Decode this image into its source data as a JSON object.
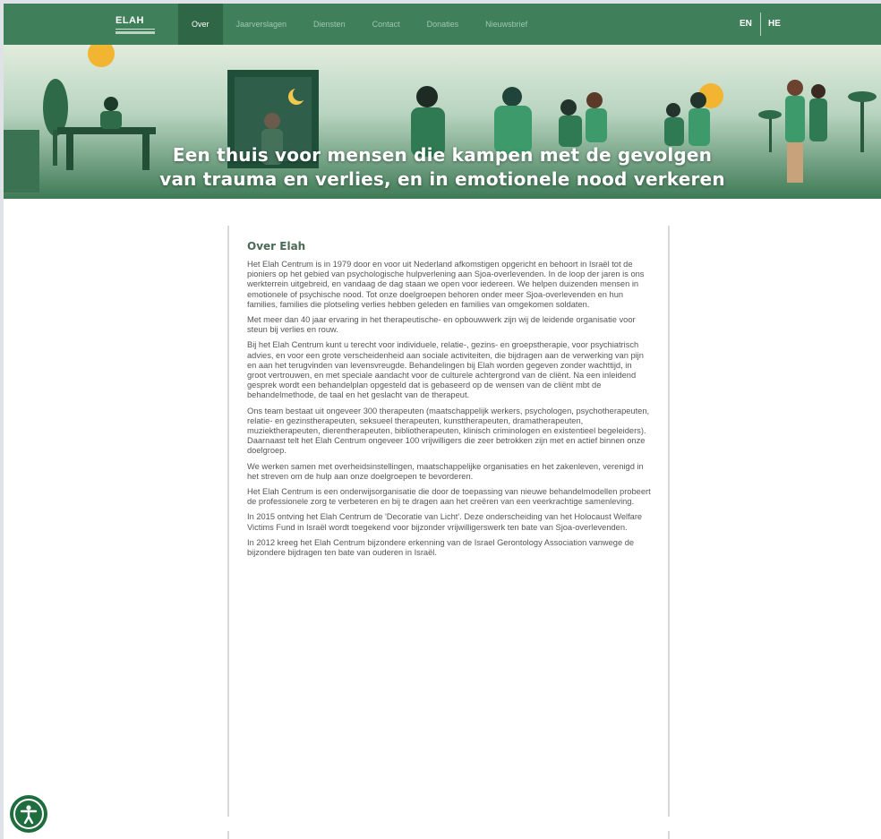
{
  "brand": {
    "logo_text": "ELAH"
  },
  "nav": {
    "items": [
      {
        "label": "Over",
        "active": true
      },
      {
        "label": "Jaarverslagen",
        "active": false
      },
      {
        "label": "Diensten",
        "active": false
      },
      {
        "label": "Contact",
        "active": false
      },
      {
        "label": "Donaties",
        "active": false
      },
      {
        "label": "Nieuwsbrief",
        "active": false
      }
    ],
    "languages": [
      "EN",
      "HE"
    ]
  },
  "hero": {
    "title_line1": "Een thuis voor mensen die kampen met de gevolgen",
    "title_line2": "van trauma en verlies, en in emotionele nood verkeren"
  },
  "article": {
    "heading": "Over Elah",
    "paragraphs": [
      "Het Elah Centrum is in 1979 door en voor uit Nederland afkomstigen opgericht en behoort in Israël tot de pioniers op het gebied van psychologische hulpverlening aan Sjoa-overlevenden. In de loop der jaren is ons werkterrein uitgebreid, en vandaag de dag staan we open voor iedereen. We helpen duizenden mensen in emotionele of psychische nood. Tot onze doelgroepen behoren onder meer Sjoa-overlevenden en hun families, families die plotseling verlies hebben geleden en families van omgekomen soldaten.",
      "Met meer dan 40 jaar ervaring in het therapeutische- en opbouwwerk zijn wij de leidende organisatie voor steun bij verlies en rouw.",
      "Bij het Elah Centrum kunt u terecht voor individuele, relatie-, gezins- en groepstherapie, voor psychiatrisch advies, en voor een grote verscheidenheid aan sociale activiteiten, die bijdragen aan de verwerking van pijn en aan het terugvinden van levensvreugde. Behandelingen bij Elah worden gegeven zonder wachttijd, in groot vertrouwen, en met speciale aandacht voor de culturele achtergrond van de cliënt. Na een inleidend gesprek wordt een behandelplan opgesteld dat is gebaseerd op de wensen van de cliënt mbt de behandelmethode, de taal en het geslacht van de therapeut.",
      "Ons team bestaat uit ongeveer 300 therapeuten (maatschappelijk werkers, psychologen, psychotherapeuten, relatie- en gezinstherapeuten, seksueel therapeuten, kunsttherapeuten, dramatherapeuten, muziektherapeuten, dierentherapeuten, bibliotherapeuten, klinisch criminologen en existentieel begeleiders). Daarnaast telt het Elah Centrum ongeveer 100 vrijwilligers die zeer betrokken zijn met en actief binnen onze doelgroep.",
      "We werken samen met overheidsinstellingen, maatschappelijke organisaties en het zakenleven, verenigd in het streven om de hulp aan onze doelgroepen te bevorderen.",
      "Het Elah Centrum is een onderwijsorganisatie die door de toepassing van nieuwe behandelmodellen probeert de professionele zorg te verbeteren en bij te dragen aan het creëren van een veerkrachtige samenleving.",
      "In 2015 ontving het Elah Centrum de 'Decoratie van Licht'. Deze onderscheiding van het Holocaust Welfare Victims Fund in Israël wordt toegekend voor bijzonder vrijwilligerswerk ten bate van Sjoa-overlevenden.",
      "In 2012 kreeg het Elah Centrum bijzondere erkenning van de Israel Gerontology Association vanwege de bijzondere bijdragen ten bate van ouderen in Israël."
    ]
  },
  "accessibility": {
    "icon": "accessibility-icon"
  },
  "colors": {
    "nav": "#3f7f59",
    "nav_active": "#2f6645",
    "heading": "#4a6a55",
    "a11y": "#1f6d3e"
  }
}
